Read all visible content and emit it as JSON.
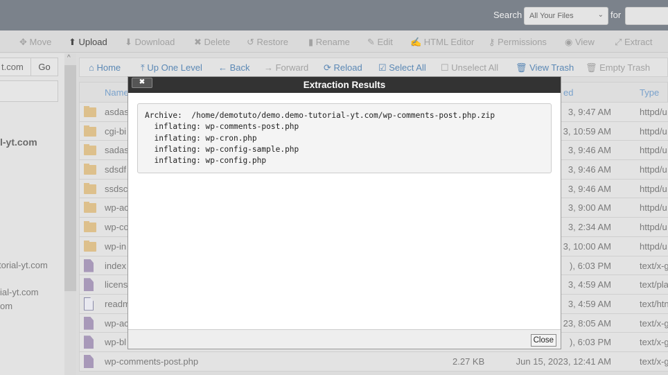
{
  "header": {
    "search_label": "Search",
    "search_scope": "All Your Files",
    "for_label": "for"
  },
  "toolbar": [
    {
      "label": "✥ Move",
      "on": false
    },
    {
      "label": "⬆ Upload",
      "on": true
    },
    {
      "label": "⬇ Download",
      "on": false
    },
    {
      "label": "✖ Delete",
      "on": false
    },
    {
      "label": "↺ Restore",
      "on": false
    },
    {
      "label": "▮ Rename",
      "on": false
    },
    {
      "label": "✎ Edit",
      "on": false
    },
    {
      "label": "✍ HTML Editor",
      "on": false
    },
    {
      "label": "⚷ Permissions",
      "on": false
    },
    {
      "label": "◉ View",
      "on": false
    },
    {
      "label": "⤢ Extract",
      "on": false
    }
  ],
  "sidebar": {
    "input_value": "t.com",
    "go_label": "Go",
    "texts": [
      "l-yt.com",
      "torial-yt.com",
      "ial-yt.com",
      "om"
    ]
  },
  "nav": [
    {
      "label": "⌂ Home",
      "dis": false
    },
    {
      "label": "⤒ Up One Level",
      "dis": false
    },
    {
      "label": "← Back",
      "dis": false
    },
    {
      "label": "→ Forward",
      "dis": true
    },
    {
      "label": "⟳ Reload",
      "dis": false
    },
    {
      "label": "☑ Select All",
      "dis": false
    },
    {
      "label": "☐ Unselect All",
      "dis": true
    },
    {
      "label": "🗑 View Trash",
      "dis": false
    },
    {
      "label": "🗑 Empty Trash",
      "dis": true
    }
  ],
  "table": {
    "headers": {
      "name": "Name",
      "modified": "ed",
      "type": "Type"
    },
    "rows": [
      {
        "icon": "folder",
        "name": "asdas",
        "size": "",
        "date": "3, 9:47 AM",
        "type": "httpd/u"
      },
      {
        "icon": "folder",
        "name": "cgi-bi",
        "size": "",
        "date": "3, 10:59 AM",
        "type": "httpd/u"
      },
      {
        "icon": "folder",
        "name": "sadas",
        "size": "",
        "date": "3, 9:46 AM",
        "type": "httpd/u"
      },
      {
        "icon": "folder",
        "name": "sdsdf",
        "size": "",
        "date": "3, 9:46 AM",
        "type": "httpd/u"
      },
      {
        "icon": "folder",
        "name": "ssdsc",
        "size": "",
        "date": "3, 9:46 AM",
        "type": "httpd/u"
      },
      {
        "icon": "folder",
        "name": "wp-ac",
        "size": "",
        "date": "3, 9:00 AM",
        "type": "httpd/u"
      },
      {
        "icon": "folder",
        "name": "wp-co",
        "size": "",
        "date": "3, 2:34 AM",
        "type": "httpd/u"
      },
      {
        "icon": "folder",
        "name": "wp-in",
        "size": "",
        "date": "3, 10:00 AM",
        "type": "httpd/u"
      },
      {
        "icon": "file",
        "name": "index",
        "size": "",
        "date": "), 6:03 PM",
        "type": "text/x-g"
      },
      {
        "icon": "file",
        "name": "licens",
        "size": "",
        "date": "3, 4:59 AM",
        "type": "text/pla"
      },
      {
        "icon": "code",
        "name": "readm",
        "size": "",
        "date": "3, 4:59 AM",
        "type": "text/htn"
      },
      {
        "icon": "file",
        "name": "wp-ac",
        "size": "",
        "date": "23, 8:05 AM",
        "type": "text/x-g"
      },
      {
        "icon": "file",
        "name": "wp-bl",
        "size": "",
        "date": "), 6:03 PM",
        "type": "text/x-g"
      },
      {
        "icon": "file",
        "name": "wp-comments-post.php",
        "size": "2.27 KB",
        "date": "Jun 15, 2023, 12:41 AM",
        "type": "text/x-g"
      }
    ]
  },
  "modal": {
    "title": "Extraction Results",
    "close_x": "✖",
    "output": "Archive:  /home/demotuto/demo.demo-tutorial-yt.com/wp-comments-post.php.zip\n  inflating: wp-comments-post.php\n  inflating: wp-cron.php\n  inflating: wp-config-sample.php\n  inflating: wp-config.php",
    "close_label": "Close"
  }
}
